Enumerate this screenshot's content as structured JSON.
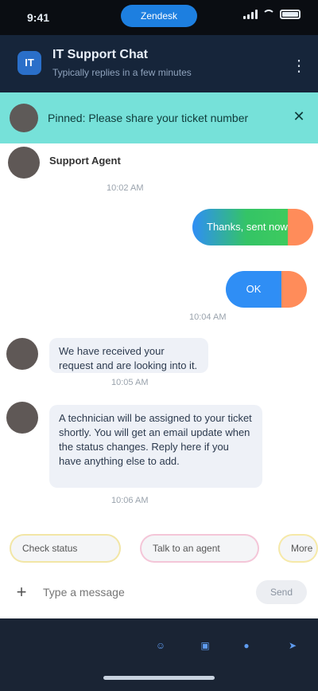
{
  "status_bar": {
    "time": "9:41",
    "center_pill": "Zendesk"
  },
  "header": {
    "badge": "IT",
    "title": "IT Support Chat",
    "subtitle": "Typically replies in a few minutes"
  },
  "banner": {
    "text": "Pinned: Please share your ticket number"
  },
  "messages": [
    {
      "sender": "Support Agent",
      "text": "",
      "time": "10:02 AM"
    },
    {
      "sender": "",
      "text": "Thanks, sent now",
      "time": "",
      "outgoing": true,
      "color": "#34c466"
    },
    {
      "sender": "",
      "text": "OK",
      "time": "10:04 AM",
      "outgoing": true,
      "color": "#2f8ef5"
    },
    {
      "sender": "",
      "text": "We have received your request and are looking into it.",
      "time": "10:05 AM"
    },
    {
      "sender": "",
      "text": "A technician will be assigned to your ticket shortly. You will get an email update when the status changes. Reply here if you have anything else to add.",
      "time": "10:06 AM"
    }
  ],
  "quick_replies": [
    {
      "label": "Check status",
      "accent": "#f2e6a6"
    },
    {
      "label": "Talk to an agent",
      "accent": "#f4c6d8"
    },
    {
      "label": "More",
      "accent": "#f6e9a8"
    }
  ],
  "input": {
    "placeholder": "Type a message",
    "send_label": "Send"
  },
  "toolbar": {
    "items": [
      "",
      "",
      "",
      ""
    ]
  },
  "colors": {
    "header_bg": "#16253a",
    "banner_bg": "#76e1d9",
    "outgoing_green": "#34c466",
    "outgoing_blue": "#2f8ef5",
    "bottom_bg": "#1a2434"
  }
}
